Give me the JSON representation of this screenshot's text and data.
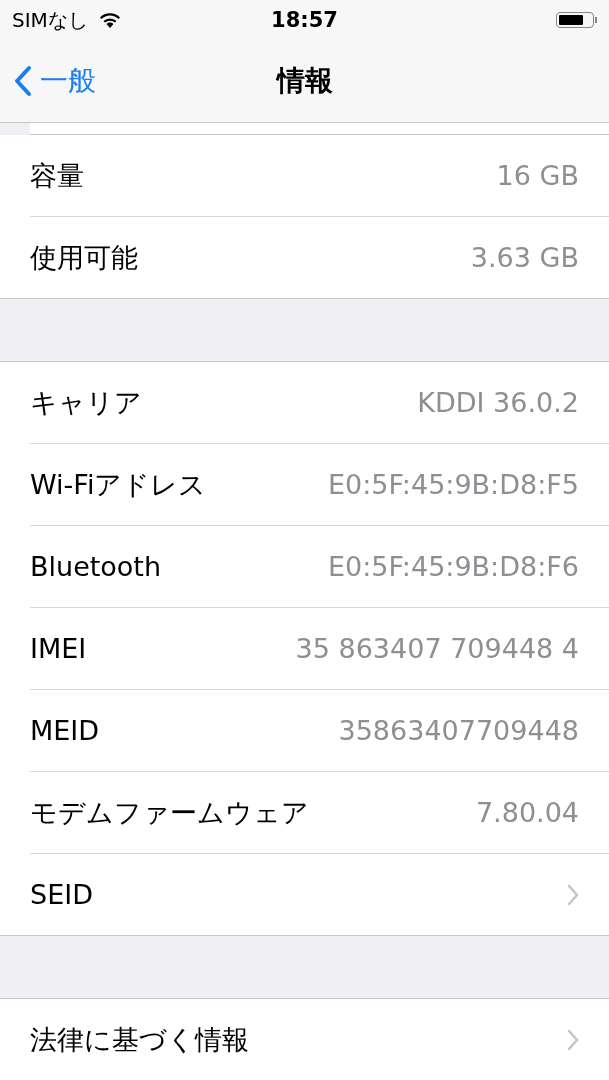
{
  "status_bar": {
    "carrier": "SIMなし",
    "time": "18:57"
  },
  "nav": {
    "back": "一般",
    "title": "情報"
  },
  "sections": [
    {
      "rows": [
        {
          "kind": "value",
          "label": "容量",
          "value": "16 GB"
        },
        {
          "kind": "value",
          "label": "使用可能",
          "value": "3.63 GB"
        }
      ]
    },
    {
      "rows": [
        {
          "kind": "value",
          "label": "キャリア",
          "value": "KDDI 36.0.2"
        },
        {
          "kind": "value",
          "label": "Wi-Fiアドレス",
          "value": "E0:5F:45:9B:D8:F5"
        },
        {
          "kind": "value",
          "label": "Bluetooth",
          "value": "E0:5F:45:9B:D8:F6"
        },
        {
          "kind": "value",
          "label": "IMEI",
          "value": "35 863407 709448 4"
        },
        {
          "kind": "value",
          "label": "MEID",
          "value": "35863407709448"
        },
        {
          "kind": "value",
          "label": "モデムファームウェア",
          "value": "7.80.04"
        },
        {
          "kind": "disclosure",
          "label": "SEID"
        }
      ]
    },
    {
      "rows": [
        {
          "kind": "disclosure",
          "label": "法律に基づく情報"
        }
      ]
    }
  ]
}
